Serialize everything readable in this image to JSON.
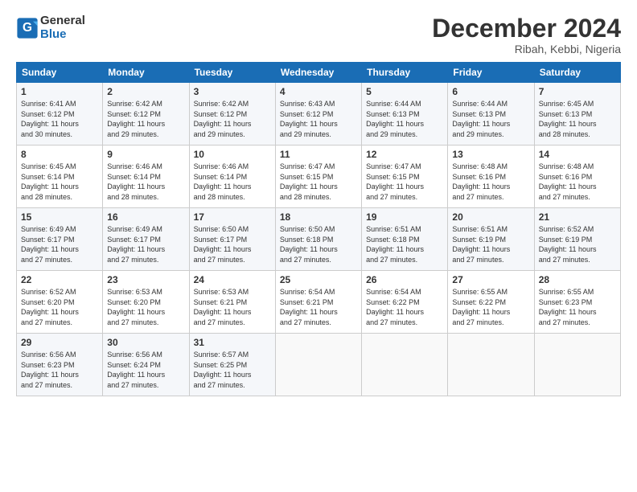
{
  "logo": {
    "text_general": "General",
    "text_blue": "Blue"
  },
  "header": {
    "month": "December 2024",
    "location": "Ribah, Kebbi, Nigeria"
  },
  "weekdays": [
    "Sunday",
    "Monday",
    "Tuesday",
    "Wednesday",
    "Thursday",
    "Friday",
    "Saturday"
  ],
  "weeks": [
    [
      {
        "day": "1",
        "sunrise": "6:41 AM",
        "sunset": "6:12 PM",
        "daylight": "11 hours and 30 minutes."
      },
      {
        "day": "2",
        "sunrise": "6:42 AM",
        "sunset": "6:12 PM",
        "daylight": "11 hours and 29 minutes."
      },
      {
        "day": "3",
        "sunrise": "6:42 AM",
        "sunset": "6:12 PM",
        "daylight": "11 hours and 29 minutes."
      },
      {
        "day": "4",
        "sunrise": "6:43 AM",
        "sunset": "6:12 PM",
        "daylight": "11 hours and 29 minutes."
      },
      {
        "day": "5",
        "sunrise": "6:44 AM",
        "sunset": "6:13 PM",
        "daylight": "11 hours and 29 minutes."
      },
      {
        "day": "6",
        "sunrise": "6:44 AM",
        "sunset": "6:13 PM",
        "daylight": "11 hours and 29 minutes."
      },
      {
        "day": "7",
        "sunrise": "6:45 AM",
        "sunset": "6:13 PM",
        "daylight": "11 hours and 28 minutes."
      }
    ],
    [
      {
        "day": "8",
        "sunrise": "6:45 AM",
        "sunset": "6:14 PM",
        "daylight": "11 hours and 28 minutes."
      },
      {
        "day": "9",
        "sunrise": "6:46 AM",
        "sunset": "6:14 PM",
        "daylight": "11 hours and 28 minutes."
      },
      {
        "day": "10",
        "sunrise": "6:46 AM",
        "sunset": "6:14 PM",
        "daylight": "11 hours and 28 minutes."
      },
      {
        "day": "11",
        "sunrise": "6:47 AM",
        "sunset": "6:15 PM",
        "daylight": "11 hours and 28 minutes."
      },
      {
        "day": "12",
        "sunrise": "6:47 AM",
        "sunset": "6:15 PM",
        "daylight": "11 hours and 27 minutes."
      },
      {
        "day": "13",
        "sunrise": "6:48 AM",
        "sunset": "6:16 PM",
        "daylight": "11 hours and 27 minutes."
      },
      {
        "day": "14",
        "sunrise": "6:48 AM",
        "sunset": "6:16 PM",
        "daylight": "11 hours and 27 minutes."
      }
    ],
    [
      {
        "day": "15",
        "sunrise": "6:49 AM",
        "sunset": "6:17 PM",
        "daylight": "11 hours and 27 minutes."
      },
      {
        "day": "16",
        "sunrise": "6:49 AM",
        "sunset": "6:17 PM",
        "daylight": "11 hours and 27 minutes."
      },
      {
        "day": "17",
        "sunrise": "6:50 AM",
        "sunset": "6:17 PM",
        "daylight": "11 hours and 27 minutes."
      },
      {
        "day": "18",
        "sunrise": "6:50 AM",
        "sunset": "6:18 PM",
        "daylight": "11 hours and 27 minutes."
      },
      {
        "day": "19",
        "sunrise": "6:51 AM",
        "sunset": "6:18 PM",
        "daylight": "11 hours and 27 minutes."
      },
      {
        "day": "20",
        "sunrise": "6:51 AM",
        "sunset": "6:19 PM",
        "daylight": "11 hours and 27 minutes."
      },
      {
        "day": "21",
        "sunrise": "6:52 AM",
        "sunset": "6:19 PM",
        "daylight": "11 hours and 27 minutes."
      }
    ],
    [
      {
        "day": "22",
        "sunrise": "6:52 AM",
        "sunset": "6:20 PM",
        "daylight": "11 hours and 27 minutes."
      },
      {
        "day": "23",
        "sunrise": "6:53 AM",
        "sunset": "6:20 PM",
        "daylight": "11 hours and 27 minutes."
      },
      {
        "day": "24",
        "sunrise": "6:53 AM",
        "sunset": "6:21 PM",
        "daylight": "11 hours and 27 minutes."
      },
      {
        "day": "25",
        "sunrise": "6:54 AM",
        "sunset": "6:21 PM",
        "daylight": "11 hours and 27 minutes."
      },
      {
        "day": "26",
        "sunrise": "6:54 AM",
        "sunset": "6:22 PM",
        "daylight": "11 hours and 27 minutes."
      },
      {
        "day": "27",
        "sunrise": "6:55 AM",
        "sunset": "6:22 PM",
        "daylight": "11 hours and 27 minutes."
      },
      {
        "day": "28",
        "sunrise": "6:55 AM",
        "sunset": "6:23 PM",
        "daylight": "11 hours and 27 minutes."
      }
    ],
    [
      {
        "day": "29",
        "sunrise": "6:56 AM",
        "sunset": "6:23 PM",
        "daylight": "11 hours and 27 minutes."
      },
      {
        "day": "30",
        "sunrise": "6:56 AM",
        "sunset": "6:24 PM",
        "daylight": "11 hours and 27 minutes."
      },
      {
        "day": "31",
        "sunrise": "6:57 AM",
        "sunset": "6:25 PM",
        "daylight": "11 hours and 27 minutes."
      },
      null,
      null,
      null,
      null
    ]
  ]
}
